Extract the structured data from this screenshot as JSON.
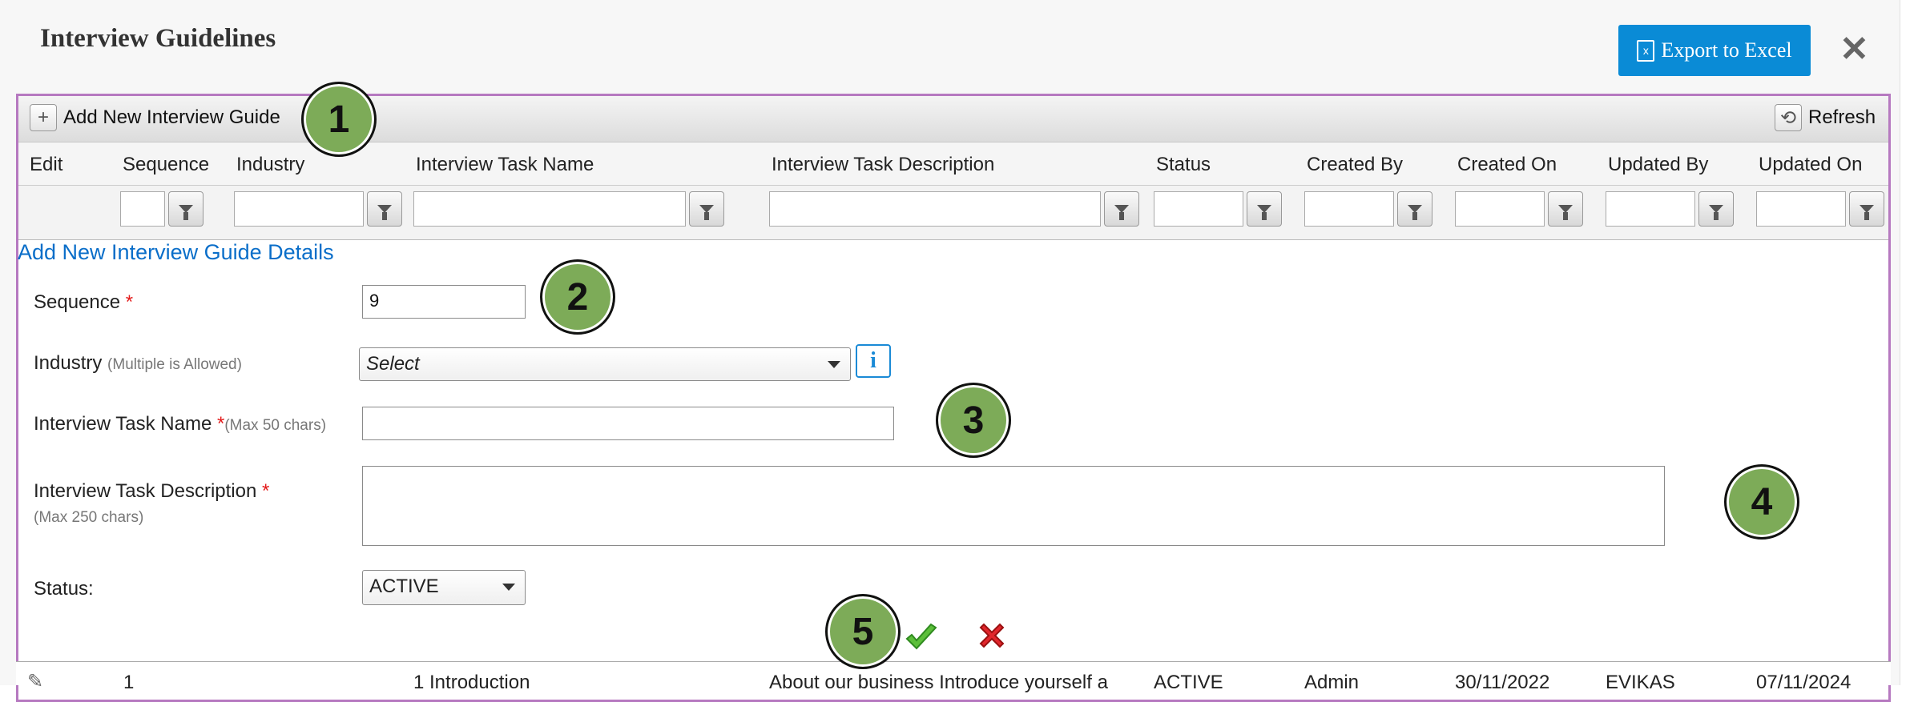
{
  "dialog": {
    "title": "Interview Guidelines",
    "export_label": "Export to Excel",
    "export_icon_letter": "x"
  },
  "toolbar": {
    "add_label": "Add New Interview Guide",
    "refresh_label": "Refresh"
  },
  "columns": [
    "Edit",
    "Sequence",
    "Industry",
    "Interview Task Name",
    "Interview Task Description",
    "Status",
    "Created By",
    "Created On",
    "Updated By",
    "Updated On"
  ],
  "form": {
    "title": "Add New Interview Guide Details",
    "sequence_label": "Sequence",
    "sequence_value": "9",
    "required_mark": "*",
    "industry_label": "Industry",
    "industry_hint": "(Multiple is Allowed)",
    "industry_placeholder": "Select",
    "info_glyph": "i",
    "task_name_label": "Interview Task Name",
    "task_name_hint": "(Max 50 chars)",
    "task_desc_label": "Interview Task Description",
    "task_desc_hint": "(Max 250 chars)",
    "status_label": "Status:",
    "status_value": "ACTIVE"
  },
  "row": {
    "sequence": "1",
    "task_name": "1 Introduction",
    "description": "About our business Introduce yourself a",
    "status": "ACTIVE",
    "created_by": "Admin",
    "created_on": "30/11/2022",
    "updated_by": "EVIKAS",
    "updated_on": "07/11/2024"
  },
  "markers": [
    "1",
    "2",
    "3",
    "4",
    "5"
  ],
  "colors": {
    "accent": "#0a8bd6",
    "border": "#b679c0",
    "marker": "#7dab58",
    "required": "#e31a1a"
  }
}
